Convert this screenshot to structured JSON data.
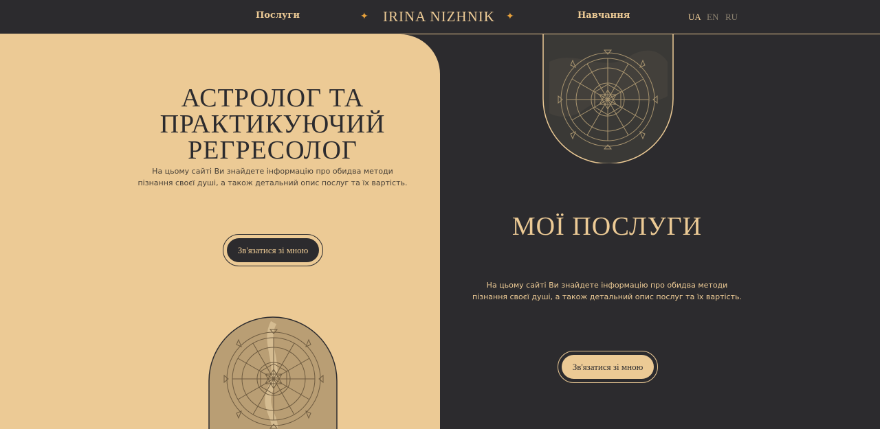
{
  "nav": {
    "services": "Послуги",
    "brand": "IRINA NIZHNIK",
    "training": "Навчання",
    "languages": [
      "UA",
      "EN",
      "RU"
    ],
    "star": "✦"
  },
  "hero": {
    "title_lines": [
      "АСТРОЛОГ ТА",
      "ПРАКТИКУЮЧИЙ",
      "РЕГРЕСОЛОГ"
    ],
    "desc_lines": [
      "На цьому сайті Ви знайдете інформацію про обидва методи",
      "пізнання своєї душі, а також детальний опис послуг та їх вартість."
    ],
    "button": "Зв'язатися зі мною"
  },
  "services": {
    "title": "МОЇ ПОСЛУГИ",
    "desc_lines": [
      "На цьому сайті Ви знайдете інформацію про обидва методи",
      "пізнання своєї душі, а також детальний опис послуг та їх вартість."
    ],
    "button": "Зв'язатися зі мною"
  },
  "colors": {
    "dark": "#2c2b2e",
    "gold": "#ecca95",
    "star": "#e9a23b",
    "lang_inactive": "#8b8170"
  },
  "icons": {
    "nav_star": "four-point-star-icon",
    "zodiac_wheel": "zodiac-wheel-icon"
  }
}
